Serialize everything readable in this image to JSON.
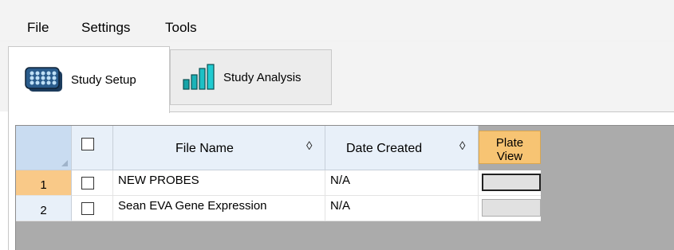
{
  "menu": {
    "file": "File",
    "settings": "Settings",
    "tools": "Tools"
  },
  "tabs": {
    "setup": {
      "label": "Study Setup",
      "icon": "plate-grid-icon"
    },
    "analysis": {
      "label": "Study Analysis",
      "icon": "bar-chart-icon"
    }
  },
  "grid": {
    "headers": {
      "file_name": "File Name",
      "date_created": "Date Created",
      "plate_view_line1": "Plate",
      "plate_view_line2": "View",
      "sort_symbol": "◊"
    },
    "rows": [
      {
        "num": "1",
        "checked": false,
        "file_name": "NEW PROBES",
        "date_created": "N/A",
        "selected": true
      },
      {
        "num": "2",
        "checked": false,
        "file_name": "Sean EVA Gene Expression",
        "date_created": "N/A",
        "selected": false
      }
    ]
  },
  "colors": {
    "selected_row_header": "#f9c988",
    "plate_view_header": "#f7c473",
    "grid_background": "#ababab",
    "header_bg": "#e8f0f9"
  }
}
